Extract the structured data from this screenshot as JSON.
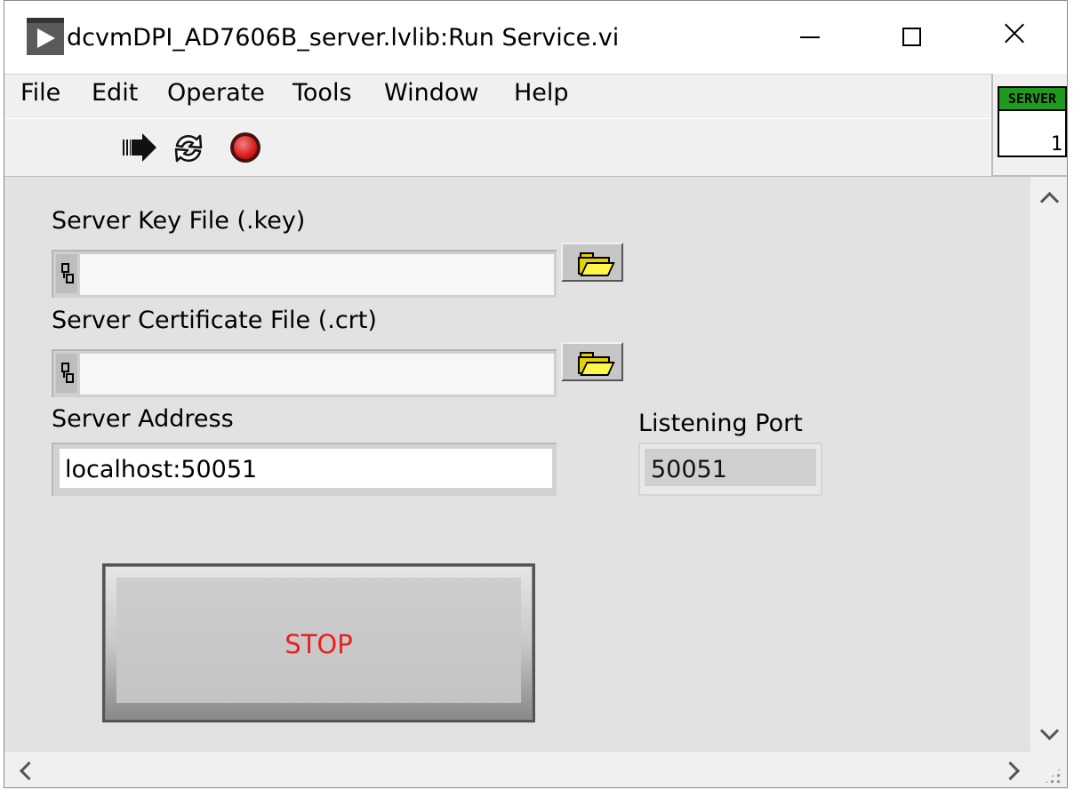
{
  "window": {
    "title": "dcvmDPI_AD7606B_server.lvlib:Run Service.vi"
  },
  "menu": {
    "items": [
      {
        "label": "File"
      },
      {
        "label": "Edit"
      },
      {
        "label": "Operate"
      },
      {
        "label": "Tools"
      },
      {
        "label": "Window"
      },
      {
        "label": "Help"
      }
    ]
  },
  "toolbar": {
    "icons": [
      "run-icon",
      "run-continuously-icon",
      "abort-icon"
    ]
  },
  "connector": {
    "label": "SERVER",
    "value": "1",
    "header_color": "#1f9a1f"
  },
  "form": {
    "key_file": {
      "label": "Server Key File (.key)",
      "value": ""
    },
    "cert_file": {
      "label": "Server Certificate File (.crt)",
      "value": ""
    },
    "address": {
      "label": "Server Address",
      "value": "localhost:50051"
    },
    "port": {
      "label": "Listening Port",
      "value": "50051"
    }
  },
  "stop_button": {
    "label": "STOP",
    "text_color": "#ee1c1c"
  },
  "colors": {
    "panel_bg": "#e2e2e2",
    "folder_yellow": "#e6d100"
  }
}
